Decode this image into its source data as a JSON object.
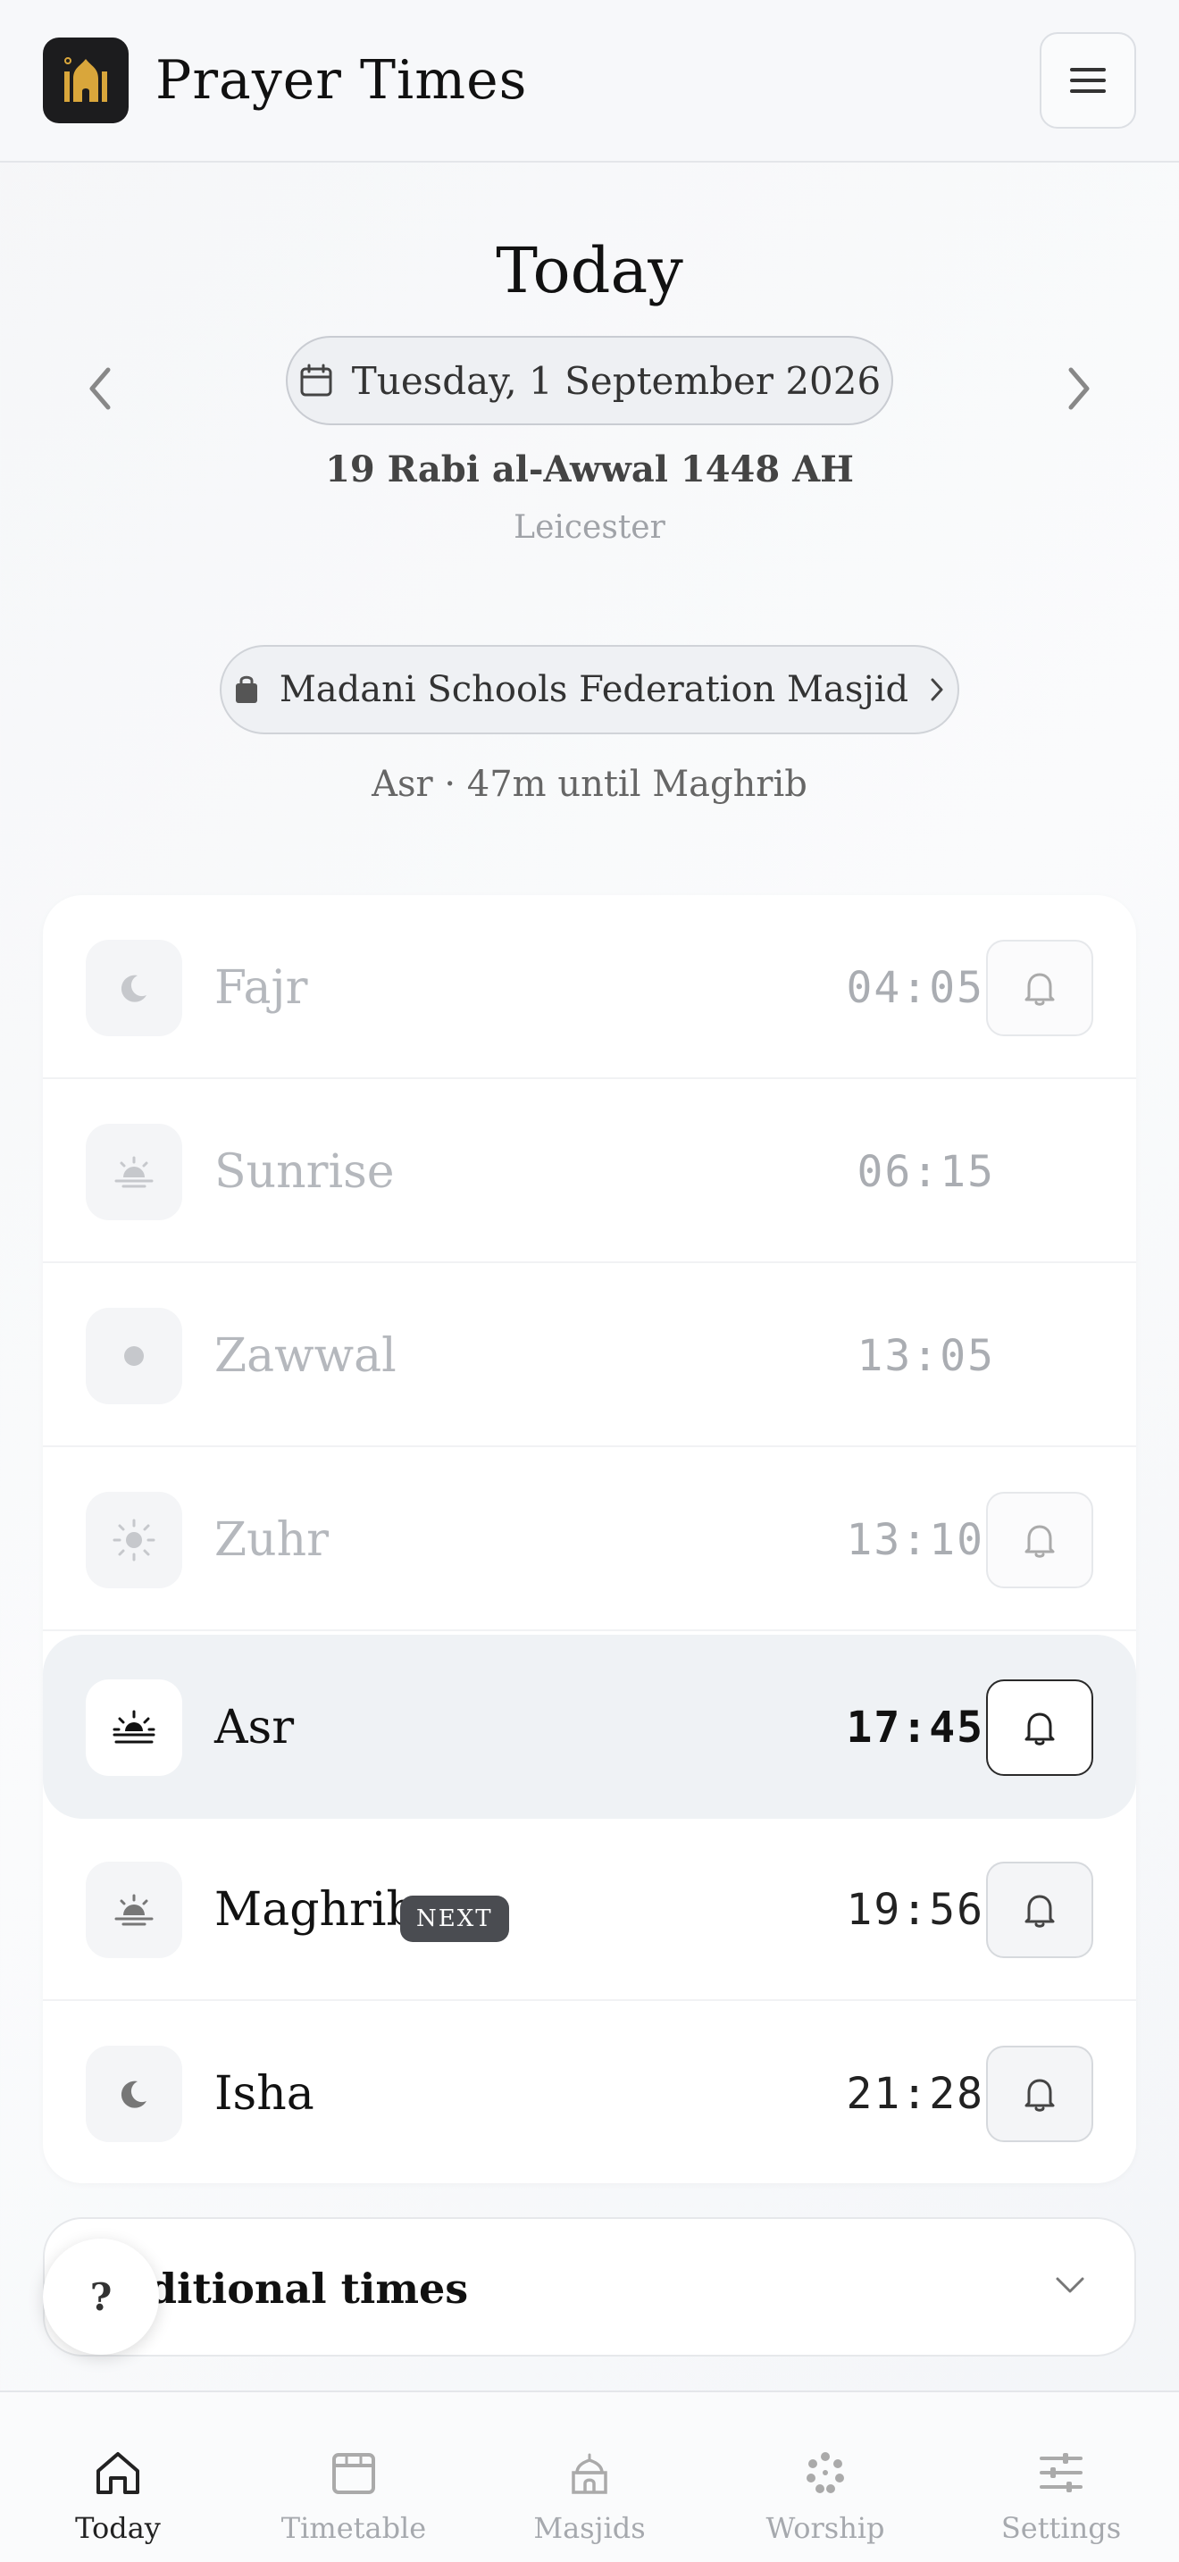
{
  "header": {
    "title": "Prayer Times",
    "logo_icon": "mosque-icon",
    "menu_icon": "hamburger-icon"
  },
  "day": {
    "title": "Today",
    "date": "Tuesday, 1 September 2026",
    "hijri": "19 Rabi al-Awwal 1448 AH",
    "city": "Leicester"
  },
  "masjid": {
    "name": "Madani Schools Federation Masjid"
  },
  "status": "Asr · 47m until Maghrib",
  "prayers": [
    {
      "name": "Fajr",
      "time": "04:05",
      "icon": "moon-icon",
      "state": "past",
      "has_bell": true
    },
    {
      "name": "Sunrise",
      "time": "06:15",
      "icon": "sunrise-icon",
      "state": "past",
      "has_bell": false
    },
    {
      "name": "Zawwal",
      "time": "13:05",
      "icon": "dot-icon",
      "state": "past",
      "has_bell": false
    },
    {
      "name": "Zuhr",
      "time": "13:10",
      "icon": "sun-icon",
      "state": "past",
      "has_bell": true
    },
    {
      "name": "Asr",
      "time": "17:45",
      "icon": "sun-horizon-icon",
      "state": "current",
      "has_bell": true
    },
    {
      "name": "Maghrib",
      "time": "19:56",
      "icon": "sunset-icon",
      "state": "next",
      "badge": "NEXT",
      "has_bell": true
    },
    {
      "name": "Isha",
      "time": "21:28",
      "icon": "moon-icon",
      "state": "upcoming",
      "has_bell": true
    }
  ],
  "additional": {
    "label": "Additional times"
  },
  "help": {
    "label": "?"
  },
  "nav": [
    {
      "label": "Today",
      "icon": "home-icon",
      "active": true
    },
    {
      "label": "Timetable",
      "icon": "calendar-icon",
      "active": false
    },
    {
      "label": "Masjids",
      "icon": "mosque-icon",
      "active": false
    },
    {
      "label": "Worship",
      "icon": "beads-icon",
      "active": false
    },
    {
      "label": "Settings",
      "icon": "sliders-icon",
      "active": false
    }
  ],
  "colors": {
    "accent_gold": "#d9a63b",
    "badge_bg": "#4a4c51",
    "current_row_bg": "#eff2f5"
  }
}
